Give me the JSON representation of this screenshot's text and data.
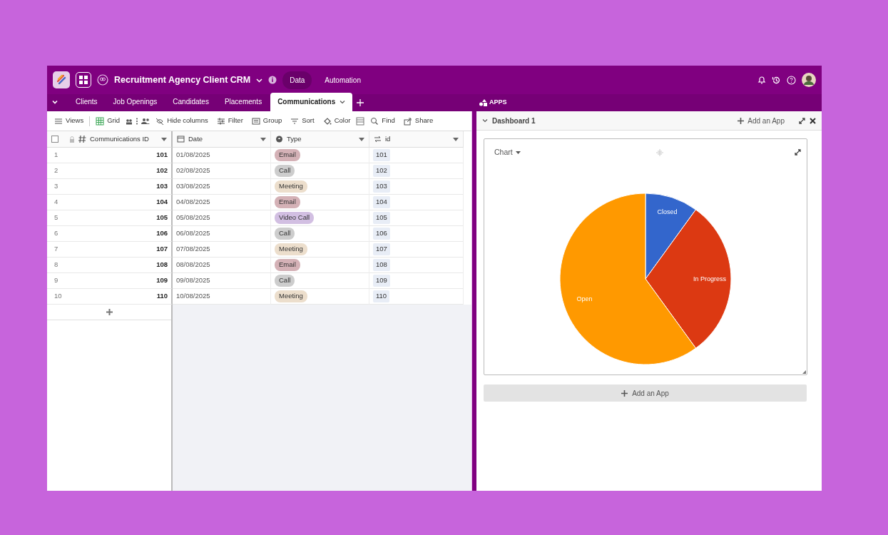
{
  "app": {
    "title": "Recruitment Agency Client CRM",
    "nav": [
      {
        "label": "Data",
        "selected": true
      },
      {
        "label": "Automation",
        "selected": false
      }
    ]
  },
  "tabs": [
    {
      "label": "Clients",
      "selected": false
    },
    {
      "label": "Job Openings",
      "selected": false
    },
    {
      "label": "Candidates",
      "selected": false
    },
    {
      "label": "Placements",
      "selected": false
    },
    {
      "label": "Communications",
      "selected": true
    }
  ],
  "toolbar": [
    "Views",
    "Grid",
    "Hide columns",
    "Filter",
    "Group",
    "Sort",
    "Color",
    "Find",
    "Share"
  ],
  "table": {
    "select_all": {
      "checked": false
    },
    "columns": [
      "Communications ID",
      "Date",
      "Type",
      "id"
    ],
    "rows": [
      {
        "num": "1",
        "comm_id": "101",
        "date": "01/08/2025",
        "type": "Email",
        "color": "#d4b1b6",
        "id": "101"
      },
      {
        "num": "2",
        "comm_id": "102",
        "date": "02/08/2025",
        "type": "Call",
        "color": "#cdcdcd",
        "id": "102"
      },
      {
        "num": "3",
        "comm_id": "103",
        "date": "03/08/2025",
        "type": "Meeting",
        "color": "#ecdecc",
        "id": "103"
      },
      {
        "num": "4",
        "comm_id": "104",
        "date": "04/08/2025",
        "type": "Email",
        "color": "#d4b1b6",
        "id": "104"
      },
      {
        "num": "5",
        "comm_id": "105",
        "date": "05/08/2025",
        "type": "Video Call",
        "color": "#d2bfe2",
        "id": "105"
      },
      {
        "num": "6",
        "comm_id": "106",
        "date": "06/08/2025",
        "type": "Call",
        "color": "#cdcdcd",
        "id": "106"
      },
      {
        "num": "7",
        "comm_id": "107",
        "date": "07/08/2025",
        "type": "Meeting",
        "color": "#ecdecc",
        "id": "107"
      },
      {
        "num": "8",
        "comm_id": "108",
        "date": "08/08/2025",
        "type": "Email",
        "color": "#d4b1b6",
        "id": "108"
      },
      {
        "num": "9",
        "comm_id": "109",
        "date": "09/08/2025",
        "type": "Call",
        "color": "#cdcdcd",
        "id": "109"
      },
      {
        "num": "10",
        "comm_id": "110",
        "date": "10/08/2025",
        "type": "Meeting",
        "color": "#ecdecc",
        "id": "110"
      }
    ]
  },
  "apps": {
    "title": "APPS",
    "dashboard": "Dashboard 1",
    "add_app": "Add an App",
    "chart_menu": "Chart",
    "add_app_button": "Add an App",
    "chart_data": {
      "type": "pie",
      "categories": [
        "Closed",
        "In Progress",
        "Open"
      ],
      "values": [
        0.1,
        0.3,
        0.6
      ],
      "colors": [
        "#3366cc",
        "#dc3912",
        "#ff9900"
      ]
    }
  }
}
